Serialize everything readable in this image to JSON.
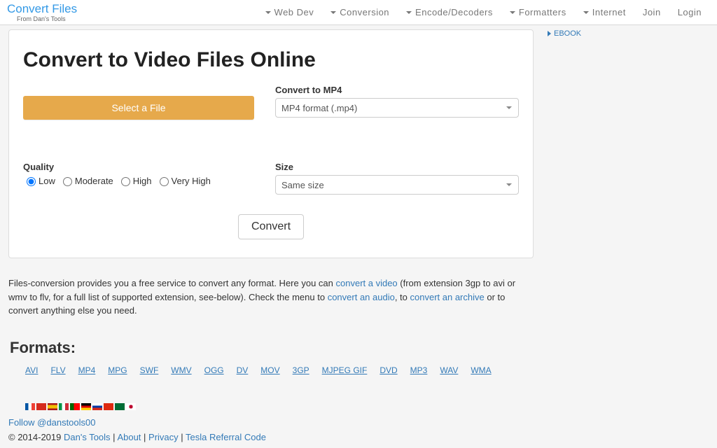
{
  "brand": {
    "top": "Convert Files",
    "bottom": "From Dan's Tools"
  },
  "nav": {
    "dropdowns": [
      "Web Dev",
      "Conversion",
      "Encode/Decoders",
      "Formatters",
      "Internet"
    ],
    "links": [
      "Join",
      "Login"
    ]
  },
  "sidebar": {
    "item": "EBOOK"
  },
  "page": {
    "title": "Convert to Video Files Online",
    "select_file": "Select a File",
    "convert_to_label": "Convert to MP4",
    "convert_to_value": "MP4 format (.mp4)",
    "quality_label": "Quality",
    "quality_options": [
      "Low",
      "Moderate",
      "High",
      "Very High"
    ],
    "quality_selected": "Low",
    "size_label": "Size",
    "size_value": "Same size",
    "convert_btn": "Convert"
  },
  "desc": {
    "pre": "Files-conversion provides you a free service to convert any format. Here you can ",
    "link_video": "convert a video",
    "mid1": " (from extension 3gp to avi or wmv to flv, for a full list of supported extension, see-below). Check the menu to ",
    "link_audio": "convert an audio",
    "mid2": ", to ",
    "link_archive": "convert an archive",
    "post": " or to convert anything else you need."
  },
  "formats": {
    "title": "Formats:",
    "list": [
      "AVI",
      "FLV",
      "MP4",
      "MPG",
      "SWF",
      "WMV",
      "OGG",
      "DV",
      "MOV",
      "3GP",
      "MJPEG GIF",
      "DVD",
      "MP3",
      "WAV",
      "WMA"
    ]
  },
  "flags": [
    "france",
    "switzerland",
    "spain",
    "italy",
    "portugal",
    "germany",
    "russia",
    "china",
    "saudi",
    "japan"
  ],
  "flag_colors": {
    "france": "linear-gradient(to right,#0055a4 33%,#fff 33% 66%,#ef4135 66%)",
    "switzerland": "#d52b1e",
    "spain": "linear-gradient(#aa151b 25%,#f1bf00 25% 75%,#aa151b 75%)",
    "italy": "linear-gradient(to right,#009246 33%,#fff 33% 66%,#ce2b37 66%)",
    "portugal": "linear-gradient(to right,#006600 40%,#ff0000 40%)",
    "germany": "linear-gradient(#000 33%,#dd0000 33% 66%,#ffce00 66%)",
    "russia": "linear-gradient(#fff 33%,#0039a6 33% 66%,#d52b1e 66%)",
    "china": "#de2910",
    "saudi": "#006c35",
    "japan": "radial-gradient(circle,#bc002d 30%,#fff 32%)"
  },
  "footer": {
    "follow": "Follow @danstools00",
    "copyright": "© 2014-2019 ",
    "links": [
      "Dan's Tools",
      "About",
      "Privacy",
      "Tesla Referral Code"
    ]
  }
}
